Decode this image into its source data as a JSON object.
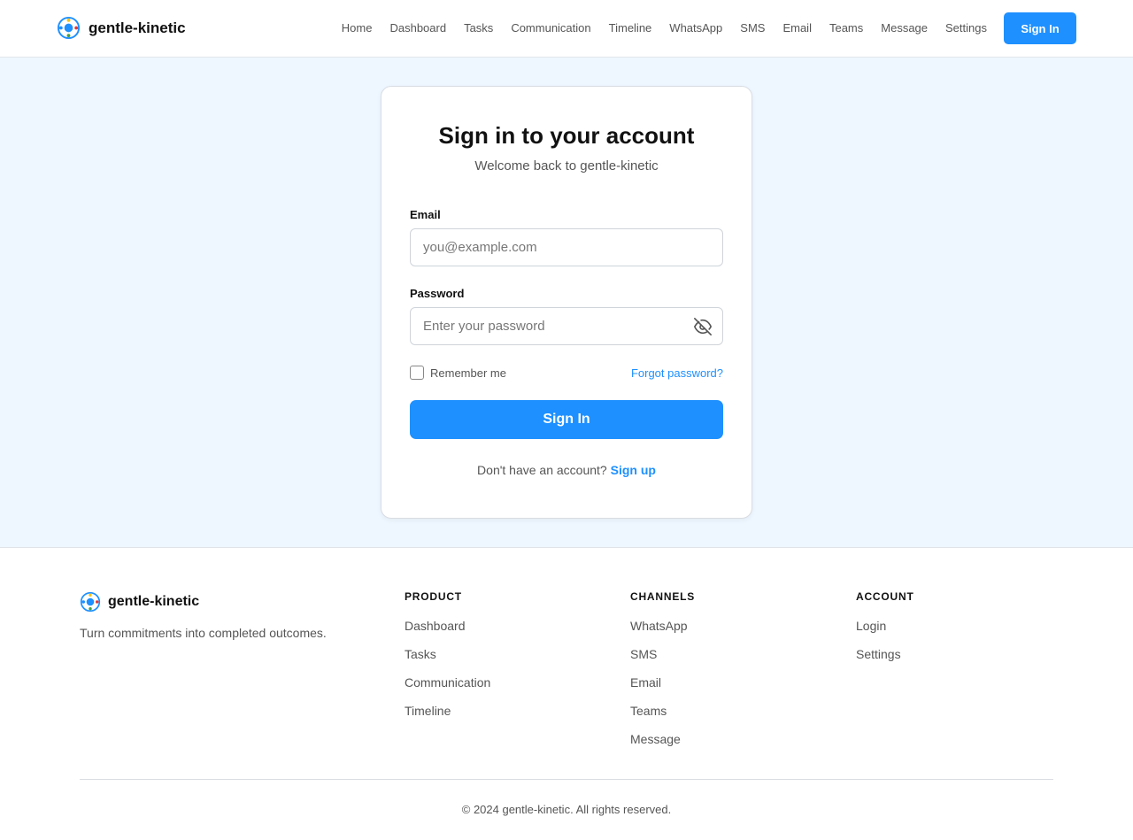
{
  "brand": {
    "name": "gentle-kinetic",
    "colors": {
      "ring": "#1e90ff",
      "dot_yellow": "#f5c518",
      "dot_red": "#e53935",
      "dot_green": "#43a047"
    }
  },
  "nav": {
    "items": [
      "Home",
      "Dashboard",
      "Tasks",
      "Communication",
      "Timeline",
      "WhatsApp",
      "SMS",
      "Email",
      "Teams",
      "Message",
      "Settings"
    ],
    "signin_label": "Sign In"
  },
  "login": {
    "title": "Sign in to your account",
    "subtitle": "Welcome back to gentle-kinetic",
    "email_label": "Email",
    "email_placeholder": "you@example.com",
    "email_value": "",
    "password_label": "Password",
    "password_placeholder": "Enter your password",
    "password_value": "",
    "toggle_icon": "eye-off-icon",
    "remember_label": "Remember me",
    "remember_checked": false,
    "forgot_label": "Forgot password?",
    "submit_label": "Sign In",
    "no_account_text": "Don't have an account?",
    "signup_label": "Sign up"
  },
  "footer": {
    "brand": "gentle-kinetic",
    "tagline": "Turn commitments into completed outcomes.",
    "columns": [
      {
        "heading": "PRODUCT",
        "links": [
          "Dashboard",
          "Tasks",
          "Communication",
          "Timeline"
        ]
      },
      {
        "heading": "CHANNELS",
        "links": [
          "WhatsApp",
          "SMS",
          "Email",
          "Teams",
          "Message"
        ]
      },
      {
        "heading": "ACCOUNT",
        "links": [
          "Login",
          "Settings"
        ]
      }
    ],
    "copyright": "© 2024 gentle-kinetic. All rights reserved."
  },
  "colors": {
    "accent": "#1e90ff",
    "page_bg": "#eef6ff"
  }
}
